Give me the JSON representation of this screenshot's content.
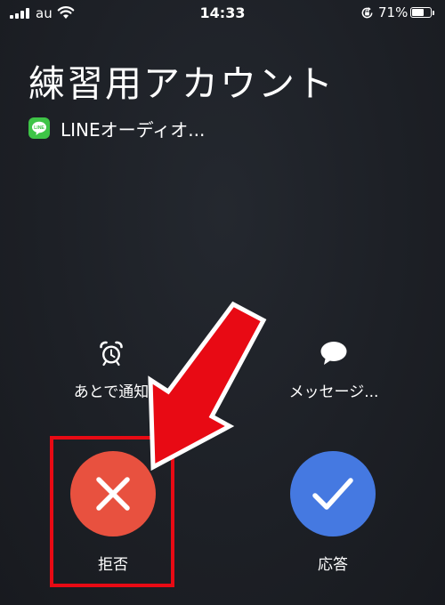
{
  "status_bar": {
    "carrier": "au",
    "time": "14:33",
    "battery_percent_label": "71%",
    "battery_level": 0.71
  },
  "caller": {
    "name": "練習用アカウント",
    "app_label": "LINEオーディオ..."
  },
  "app_icon": {
    "text": "LINE",
    "color": "#3ec447"
  },
  "actions": {
    "remind_label": "あとで通知",
    "message_label": "メッセージ..."
  },
  "buttons": {
    "decline_label": "拒否",
    "accept_label": "応答",
    "decline_color": "#e8513f",
    "accept_color": "#4579e1"
  },
  "icons": {
    "decline": "close-icon",
    "accept": "checkmark-icon",
    "remind": "alarm-clock-icon",
    "message": "speech-bubble-icon"
  },
  "annotation": {
    "color": "#e80a14"
  }
}
